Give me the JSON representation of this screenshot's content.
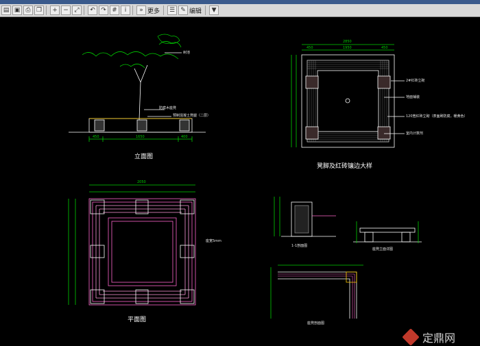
{
  "window": {
    "title": ""
  },
  "toolbar": {
    "more_label": "更多",
    "edit_label": "编辑",
    "icons": [
      "open-icon",
      "save-icon",
      "print-icon",
      "copy-icon",
      "zoom-in-icon",
      "zoom-out-icon",
      "fit-icon",
      "undo-icon",
      "redo-icon",
      "grid-icon",
      "info-icon",
      "layers-icon",
      "filter-icon"
    ]
  },
  "drawing": {
    "elevation_title": "立面图",
    "plan_title": "平面图",
    "detail_title": "凳脚及红砖镶边大样",
    "section_title": "1-1剖面图",
    "side_elevation_title": "座凳立面详图",
    "seat_plan_title": "座凳剖面图",
    "tree_label": "树池",
    "bench_note_1": "防腐木座凳",
    "bench_note_2": "预制混凝土凳腿（二层）",
    "seat_width_note": "座宽5mm",
    "right_notes": [
      "2#红砖立砌",
      "地面铺装",
      "120宽红砖立砌（表面刷防腐，暖黄色）",
      "室内计数剂"
    ],
    "dims": {
      "e1": "450",
      "e2": "1650",
      "e3": "400",
      "p_top": "2050",
      "d_top": "2850",
      "d_a": "450",
      "d_b": "1950",
      "d_c": "450"
    }
  },
  "watermark": {
    "text": "定鼎网"
  }
}
